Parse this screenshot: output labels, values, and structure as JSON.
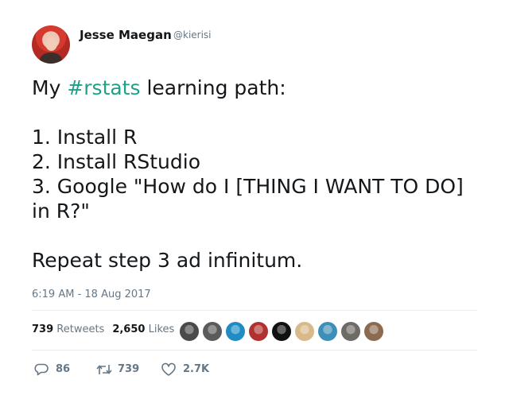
{
  "user": {
    "name": "Jesse Maegan",
    "handle": "@kierisi"
  },
  "tweet": {
    "line1_prefix": "My ",
    "hashtag": "#rstats",
    "line1_suffix": " learning path:",
    "step1": "1. Install R",
    "step2": "2. Install RStudio",
    "step3a": "3. Google \"How do I [THING I WANT TO DO]",
    "step3b": "in R?\"",
    "closing": "Repeat step 3 ad infinitum."
  },
  "timestamp": "6:19 AM - 18 Aug 2017",
  "stats": {
    "retweets_count": "739",
    "retweets_label": "Retweets",
    "likes_count": "2,650",
    "likes_label": "Likes"
  },
  "likers": [
    {
      "color": "#4a4a4a"
    },
    {
      "color": "#5b5b5b"
    },
    {
      "color": "#1f8cc4"
    },
    {
      "color": "#b0322e"
    },
    {
      "color": "#111111"
    },
    {
      "color": "#d8b98a"
    },
    {
      "color": "#3d8fb8"
    },
    {
      "color": "#6e6a66"
    },
    {
      "color": "#8c6a50"
    }
  ],
  "actions": {
    "replies": "86",
    "retweets": "739",
    "likes": "2.7K"
  },
  "colors": {
    "hashtag": "#1da18a",
    "secondary_text": "#657786"
  }
}
